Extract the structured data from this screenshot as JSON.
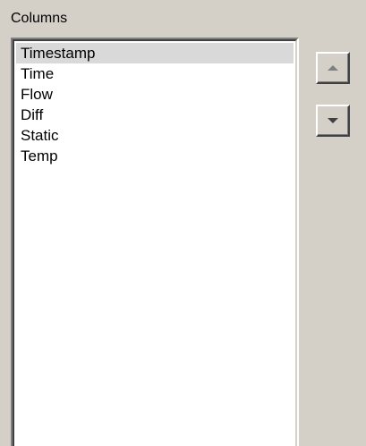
{
  "columns_panel": {
    "label": "Columns",
    "items": [
      {
        "label": "Timestamp",
        "selected": true
      },
      {
        "label": "Time",
        "selected": false
      },
      {
        "label": "Flow",
        "selected": false
      },
      {
        "label": "Diff",
        "selected": false
      },
      {
        "label": "Static",
        "selected": false
      },
      {
        "label": "Temp",
        "selected": false
      }
    ],
    "move_up_icon": "arrow-up-icon",
    "move_down_icon": "arrow-down-icon"
  },
  "colors": {
    "background": "#d4d0c8",
    "list_background": "#ffffff",
    "selection": "#d9d9d9",
    "text": "#000000"
  }
}
